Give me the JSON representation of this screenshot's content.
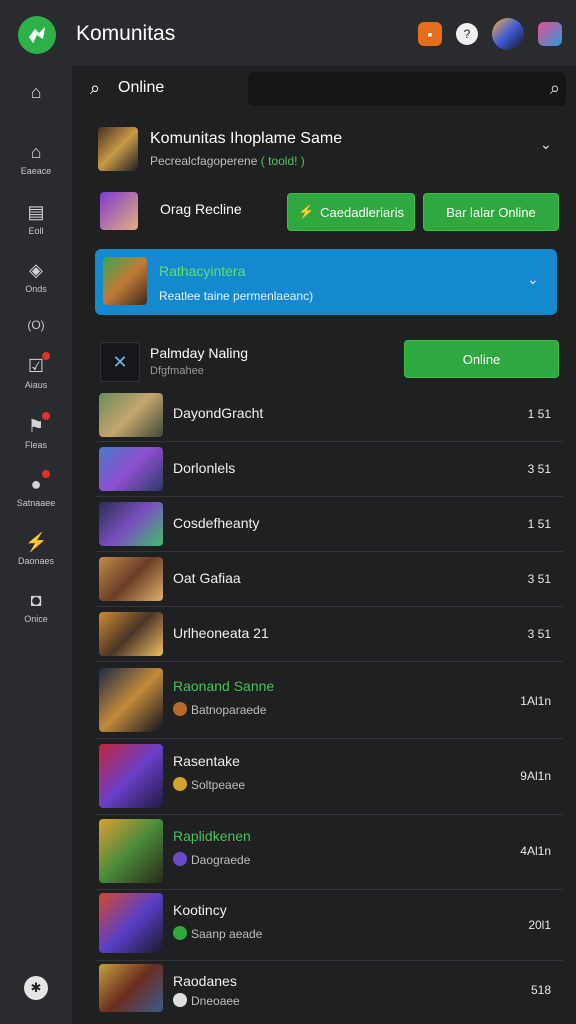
{
  "app": {
    "title": "Komunitas"
  },
  "sidebar": {
    "items": [
      {
        "icon": "home-icon",
        "label": ""
      },
      {
        "icon": "house-icon",
        "label": "Eaeace"
      },
      {
        "icon": "doc-icon",
        "label": "Eoll"
      },
      {
        "icon": "gamepad-icon",
        "label": "Onds"
      },
      {
        "icon": "circle-text",
        "label": "(O)"
      },
      {
        "icon": "check-icon",
        "label": "Aiaus"
      },
      {
        "icon": "flag-icon",
        "label": "Fleas"
      },
      {
        "icon": "record-icon",
        "label": "Satnaaee"
      },
      {
        "icon": "bolt-icon",
        "label": "Daonaes"
      },
      {
        "icon": "shield-icon",
        "label": "Onice"
      },
      {
        "icon": "bottom-icon",
        "label": ""
      }
    ]
  },
  "search": {
    "label": "Online",
    "placeholder": ""
  },
  "header_game": {
    "title": "Komunitas Ihoplame Same",
    "subtitle": "Pecrealcfagoperene",
    "subtitle_extra": "( toold! )"
  },
  "online_row": {
    "label": "Orag Recline",
    "btn1": "Caedadleriaris",
    "btn2": "Bar lalar Online"
  },
  "featured": {
    "title": "Rathacyintera",
    "subtitle": "Reatlee taine permenlaeanc)"
  },
  "section": {
    "title": "Palmday Naling",
    "subtitle": "Dfgfmahee",
    "button": "Online"
  },
  "games": [
    {
      "name": "DayondGracht",
      "value": "1 51"
    },
    {
      "name": "Dorlonlels",
      "value": "3 51"
    },
    {
      "name": "Cosdefheanty",
      "value": "1 51"
    },
    {
      "name": "Oat Gafiaa",
      "value": "3 51"
    },
    {
      "name": "Urlheoneata 21",
      "value": "3 51"
    }
  ],
  "featured_games": [
    {
      "name": "Raonand Sanne",
      "sub": "Batnoparaede",
      "value": "1Al1n"
    },
    {
      "name": "Rasentake",
      "sub": "Soltpeaee",
      "value": "9Al1n"
    },
    {
      "name": "Raplidkenen",
      "sub": "Daograede",
      "value": "4Al1n"
    },
    {
      "name": "Kootincy",
      "sub": "Saanp aeade",
      "value": "20l1"
    },
    {
      "name": "Raodanes",
      "sub": "Dneoaee",
      "value": "518"
    }
  ]
}
